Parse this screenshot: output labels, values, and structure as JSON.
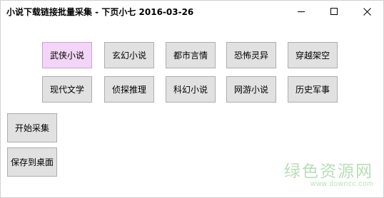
{
  "window": {
    "title": "小说下载链接批量采集 - 下页小七 2016-03-26",
    "controls": {
      "minimize_icon": "minimize-icon",
      "maximize_icon": "maximize-icon",
      "close_icon": "close-icon"
    }
  },
  "categories": {
    "row1": [
      "武侠小说",
      "玄幻小说",
      "都市言情",
      "恐怖灵异",
      "穿越架空"
    ],
    "row2": [
      "现代文学",
      "侦探推理",
      "科幻小说",
      "网游小说",
      "历史军事"
    ],
    "selected": "武侠小说"
  },
  "actions": {
    "start_label": "开始采集",
    "save_label": "保存到桌面"
  },
  "watermark": {
    "text": "绿色资源网",
    "url": "www.downcc.com"
  },
  "colors": {
    "selected_bg": "#f3d6f7",
    "button_bg": "#e1e1e1",
    "watermark": "#b8ddb8"
  }
}
